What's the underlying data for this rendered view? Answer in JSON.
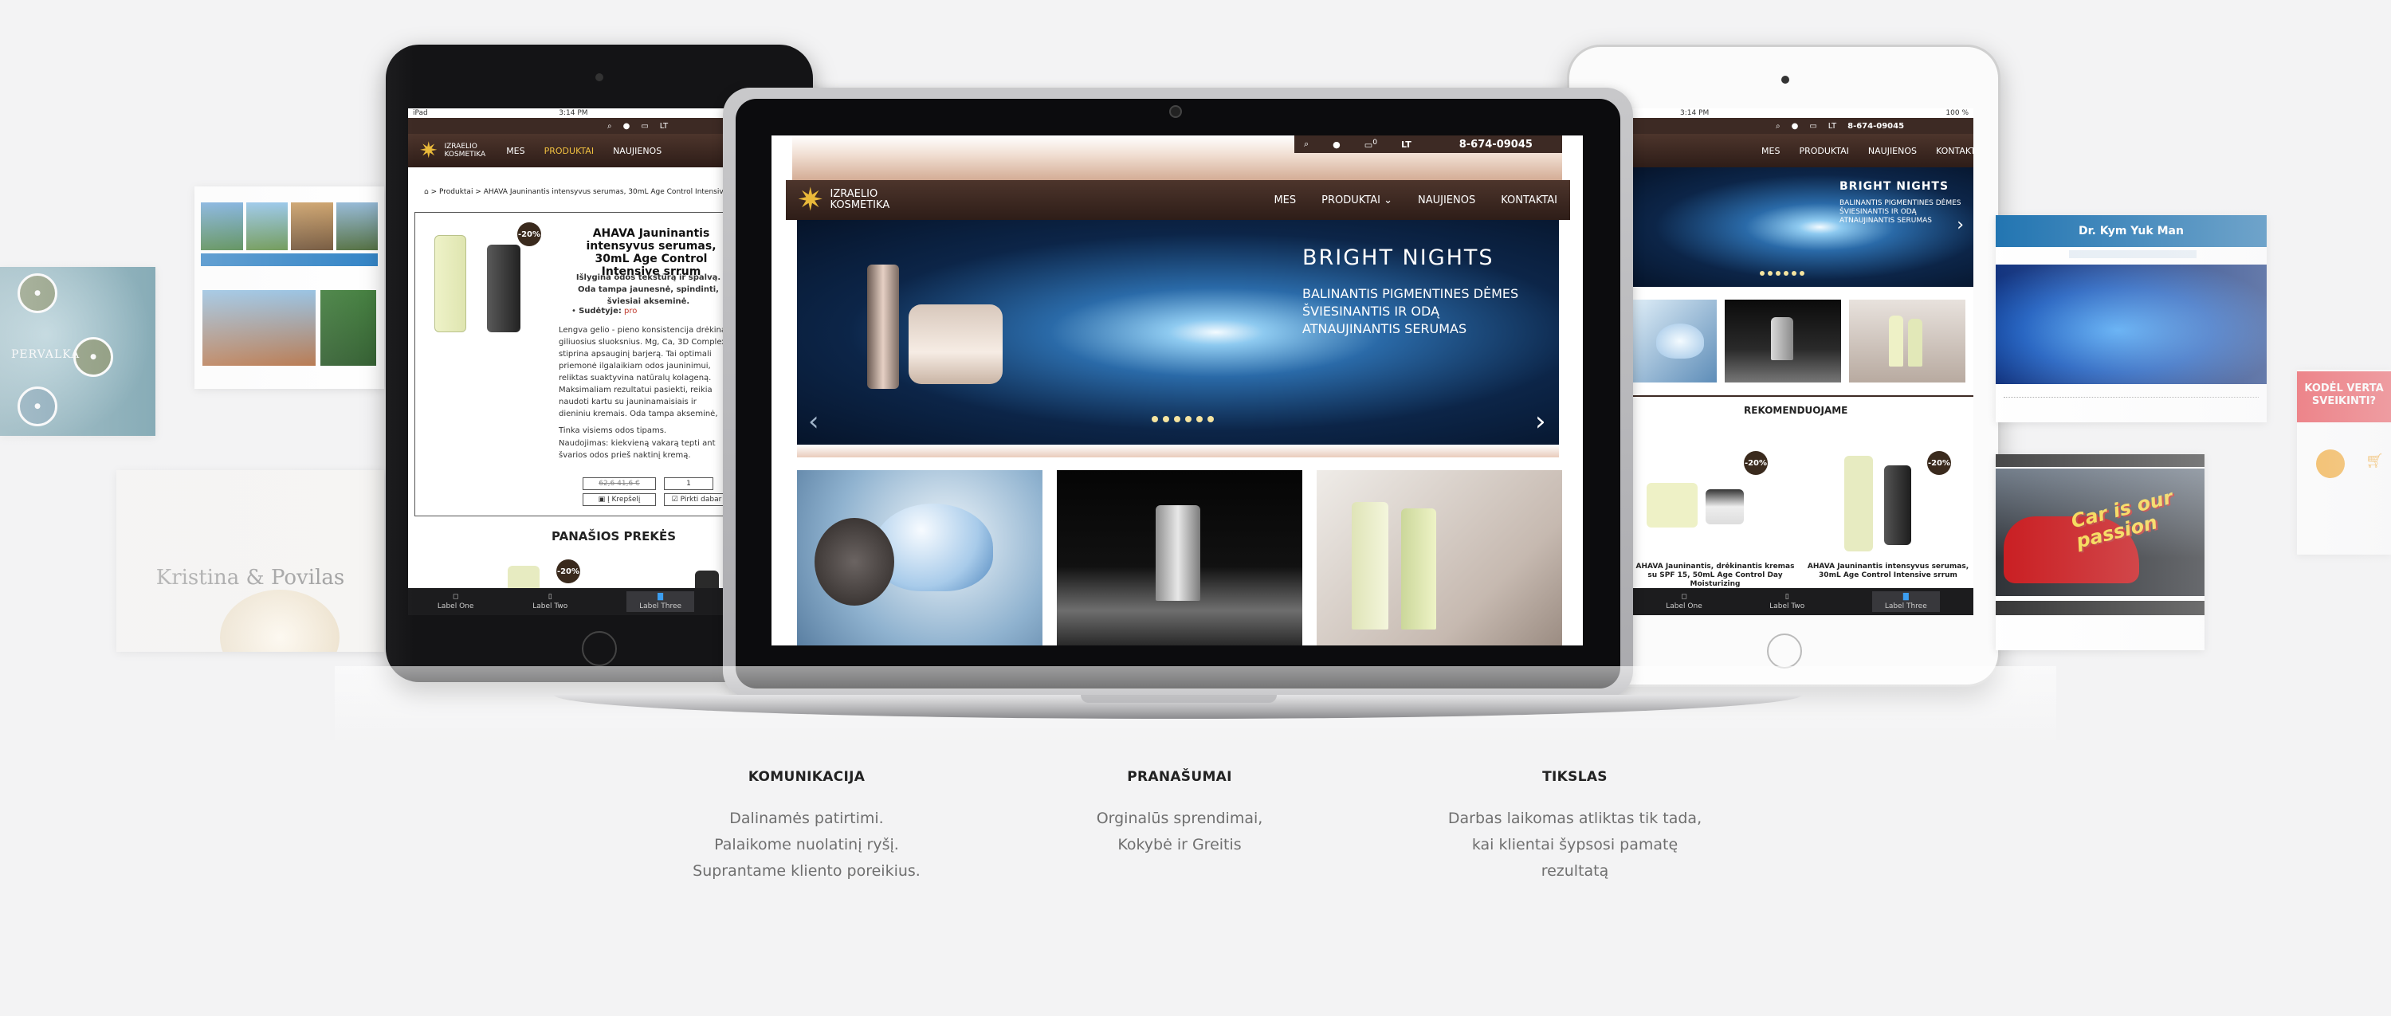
{
  "site": {
    "logo": {
      "line1": "IZRAELIO",
      "line2": "KOSMETIKA"
    },
    "phone": "8-674-09045",
    "language": "LT",
    "cart_count": "0",
    "nav": [
      "MES",
      "PRODUKTAI",
      "NAUJIENOS",
      "KONTAKTAI"
    ]
  },
  "hero": {
    "title": "BRIGHT NIGHTS",
    "subtitle_lines": [
      "BALINANTIS PIGMENTINES DĖMES",
      "ŠVIESINANTIS IR ODĄ",
      "ATNAUJINANTIS SERUMAS"
    ]
  },
  "ipad_left": {
    "status": {
      "device": "iPad",
      "time": "3:14 PM"
    },
    "breadcrumb": "> Produktai > AHAVA Jauninantis intensyvus serumas, 30mL Age Control Intensive s",
    "product_title": "AHAVA Jauninantis intensyvus serumas, 30mL Age Control Intensive srrum",
    "intro": "Išlygina odos tekstūrą ir spalvą. Oda tampa jaunesnė, spindinti, šviesiai akseminė.",
    "ingredients_label": "Sudėtyje:",
    "ingredients_value": "pro",
    "description": "Lengva gelio - pieno konsistencija drėkina giliuosius sluoksnius. Mg, Ca, 3D Complex stiprina apsauginį barjerą. Tai optimali priemonė ilgalaikiam odos jauninimui, reliktas suaktyvina natūralų kolageną. Maksimaliam rezultatui pasiekti, reikia naudoti kartu su jauninamaisiais ir dieniniu kremais. Oda tampa akseminė, lygi spalva, jaunatviškai švyti.",
    "skin_type": "Tinka visiems odos tipams.",
    "usage": "Naudojimas: kiekvieną vakarą tepti ant švarios odos prieš naktinį kremą.",
    "discount": "-20%",
    "price": "62,6 41,6 €",
    "quantity": "1",
    "cart_button": "Į Krepšelį",
    "buy_button": "Pirkti dabar",
    "related_title": "PANAŠIOS PREKĖS",
    "tabs": [
      "Label One",
      "Label Two",
      "Label Three"
    ]
  },
  "ipad_right": {
    "status": {
      "time": "3:14 PM",
      "battery": "100 %"
    },
    "recommend_title": "REKOMENDUOJAME",
    "products": [
      {
        "name": "AHAVA Jauninantis, drėkinantis kremas su SPF 15, 50mL Age Control Day Moisturizing",
        "discount": "-20%"
      },
      {
        "name": "AHAVA Jauninantis intensyvus serumas, 30mL Age Control Intensive srrum",
        "discount": "-20%"
      }
    ],
    "tabs": [
      "Label One",
      "Label Two",
      "Label Three"
    ]
  },
  "left_cards": {
    "lake_brand": "PERVALKA",
    "wedding_names": "Kristina & Povilas"
  },
  "right_cards": {
    "doctor_name": "Dr. Kym Yuk Man",
    "car_slogan": "Car is our passion",
    "why_title": "KODĖL VERTA SVEIKINTI?"
  },
  "features": [
    {
      "title": "KOMUNIKACIJA",
      "lines": [
        "Dalinamės patirtimi.",
        "Palaikome nuolatinį ryšį.",
        "Suprantame kliento poreikius."
      ]
    },
    {
      "title": "PRANAŠUMAI",
      "lines": [
        "Orginalūs sprendimai,",
        "Kokybė ir Greitis"
      ]
    },
    {
      "title": "TIKSLAS",
      "lines": [
        "Darbas laikomas atliktas tik tada,",
        "kai klientai šypsosi pamatę",
        "rezultatą"
      ]
    }
  ],
  "colors": {
    "brand_brown": "#3d2a24",
    "accent_gold": "#e9b93a",
    "discount_dark": "#3a2a1d"
  }
}
